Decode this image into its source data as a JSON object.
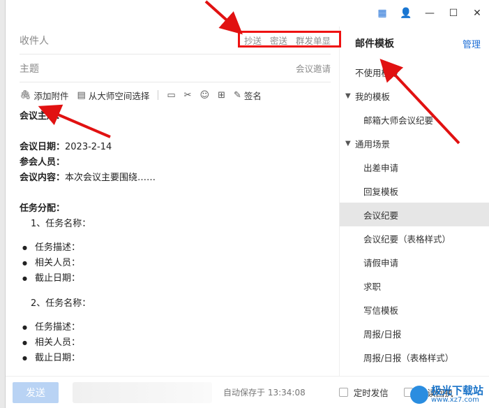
{
  "titlebar": {
    "icons": [
      "template-icon",
      "contacts-icon",
      "minimize-icon",
      "maximize-icon",
      "close-icon"
    ]
  },
  "compose": {
    "recipient_label": "收件人",
    "cc": "抄送",
    "bcc": "密送",
    "group_single": "群发单显",
    "subject_label": "主题",
    "meeting_invite": "会议邀请"
  },
  "toolbar": {
    "attach": "添加附件",
    "from_space": "从大师空间选择",
    "signature": "签名"
  },
  "body": {
    "topic": "会议主题：",
    "date_label": "会议日期：",
    "date_value": "2023-2-14",
    "attendees": "参会人员：",
    "content_label": "会议内容：",
    "content_value": "本次会议主要围绕……",
    "tasks": "任务分配：",
    "task1": "1、任务名称：",
    "desc": "任务描述：",
    "people": "相关人员：",
    "deadline": "截止日期：",
    "task2": "2、任务名称："
  },
  "sidebar": {
    "title": "邮件模板",
    "manage": "管理",
    "no_template": "不使用模板",
    "my_templates": "我的模板",
    "my_items": [
      "邮箱大师会议纪要"
    ],
    "general": "通用场景",
    "general_items": [
      "出差申请",
      "回复模板",
      "会议纪要",
      "会议纪要（表格样式）",
      "请假申请",
      "求职",
      "写信模板",
      "周报/日报",
      "周报/日报（表格样式）"
    ],
    "active_item": "会议纪要"
  },
  "footer": {
    "send": "发送",
    "autosave": "自动保存于 13:34:08",
    "scheduled": "定时发信",
    "read_receipt": "已读回执"
  },
  "watermark": {
    "text": "极光下载站",
    "sub": "www.xz7.com"
  },
  "colors": {
    "accent": "#1f6fd6",
    "annotation": "#e11111",
    "send_disabled": "#b9d3f4",
    "active_item_bg": "#e6e6e6"
  }
}
